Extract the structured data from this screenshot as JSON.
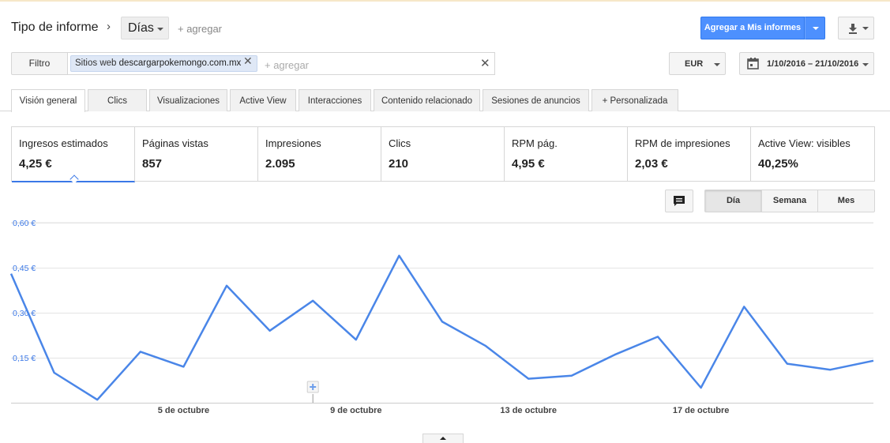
{
  "header": {
    "report_type_label": "Tipo de informe",
    "breadcrumb_sep": "›",
    "granularity_dropdown": "Días",
    "add_link": "+ agregar",
    "add_to_reports_button": "Agregar a Mis informes"
  },
  "filter": {
    "button_label": "Filtro",
    "chip_prefix": "Sitios web",
    "chip_value": "descargarpokemongo.com.mx",
    "add_placeholder": "+ agregar",
    "currency": "EUR",
    "date_range": "1/10/2016 – 21/10/2016"
  },
  "tabs": [
    {
      "label": "Visión general",
      "active": true
    },
    {
      "label": "Clics",
      "active": false
    },
    {
      "label": "Visualizaciones",
      "active": false
    },
    {
      "label": "Active View",
      "active": false
    },
    {
      "label": "Interacciones",
      "active": false
    },
    {
      "label": "Contenido relacionado",
      "active": false
    },
    {
      "label": "Sesiones de anuncios",
      "active": false
    },
    {
      "label": "+ Personalizada",
      "active": false
    }
  ],
  "metrics": [
    {
      "label": "Ingresos estimados",
      "value": "4,25 €"
    },
    {
      "label": "Páginas vistas",
      "value": "857"
    },
    {
      "label": "Impresiones",
      "value": "2.095"
    },
    {
      "label": "Clics",
      "value": "210"
    },
    {
      "label": "RPM pág.",
      "value": "4,95 €"
    },
    {
      "label": "RPM de impresiones",
      "value": "2,03 €"
    },
    {
      "label": "Active View: visibles",
      "value": "40,25%"
    }
  ],
  "granularity": {
    "options": [
      "Día",
      "Semana",
      "Mes"
    ],
    "selected": "Día"
  },
  "chart_data": {
    "type": "line",
    "x": [
      "1/10/2016",
      "2/10/2016",
      "3/10/2016",
      "4/10/2016",
      "5/10/2016",
      "6/10/2016",
      "7/10/2016",
      "8/10/2016",
      "9/10/2016",
      "10/10/2016",
      "11/10/2016",
      "12/10/2016",
      "13/10/2016",
      "14/10/2016",
      "15/10/2016",
      "16/10/2016",
      "17/10/2016",
      "18/10/2016",
      "19/10/2016",
      "20/10/2016",
      "21/10/2016"
    ],
    "series": [
      {
        "values": [
          0.43,
          0.1,
          0.01,
          0.17,
          0.12,
          0.39,
          0.24,
          0.34,
          0.21,
          0.49,
          0.27,
          0.19,
          0.08,
          0.09,
          0.16,
          0.22,
          0.05,
          0.32,
          0.13,
          0.11,
          0.14
        ]
      }
    ],
    "yticks": [
      "0,15 €",
      "0,30 €",
      "0,45 €",
      "0,60 €"
    ],
    "ytick_values": [
      0.15,
      0.3,
      0.45,
      0.6
    ],
    "xticks": [
      "5 de octubre",
      "9 de octubre",
      "13 de octubre",
      "17 de octubre"
    ],
    "xtick_index": [
      4,
      8,
      12,
      16
    ],
    "annotation_index": 7,
    "ylim": [
      0,
      0.6
    ],
    "grid": true,
    "color": "#4a86e8",
    "title": "",
    "xlabel": "",
    "ylabel": ""
  },
  "colors": {
    "accent": "#4d90fe",
    "line": "#4a86e8",
    "active_underline": "#3b78e7"
  }
}
